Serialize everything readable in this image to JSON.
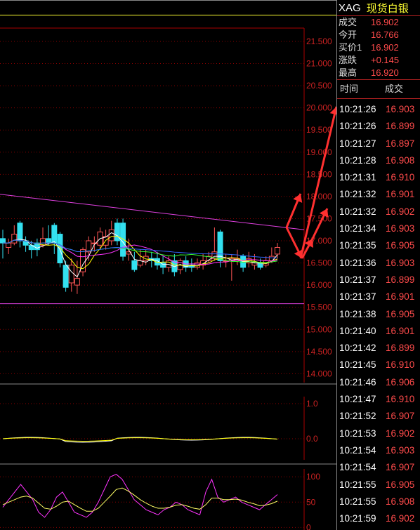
{
  "instrument": {
    "code": "XAG",
    "name": "现货白银"
  },
  "quote": [
    {
      "label": "成交",
      "value": "16.902"
    },
    {
      "label": "今开",
      "value": "16.766"
    },
    {
      "label": "买价1",
      "value": "16.902"
    },
    {
      "label": "涨跌",
      "value": "+0.145"
    },
    {
      "label": "最高",
      "value": "16.920"
    }
  ],
  "tick_header": {
    "time": "时间",
    "price": "成交"
  },
  "ticks": [
    {
      "time": "10:21:26",
      "price": "16.903"
    },
    {
      "time": "10:21:26",
      "price": "16.899"
    },
    {
      "time": "10:21:27",
      "price": "16.897"
    },
    {
      "time": "10:21:28",
      "price": "16.908"
    },
    {
      "time": "10:21:31",
      "price": "16.910"
    },
    {
      "time": "10:21:32",
      "price": "16.901"
    },
    {
      "time": "10:21:32",
      "price": "16.902"
    },
    {
      "time": "10:21:34",
      "price": "16.903"
    },
    {
      "time": "10:21:35",
      "price": "16.905"
    },
    {
      "time": "10:21:36",
      "price": "16.903"
    },
    {
      "time": "10:21:37",
      "price": "16.899"
    },
    {
      "time": "10:21:37",
      "price": "16.901"
    },
    {
      "time": "10:21:38",
      "price": "16.905"
    },
    {
      "time": "10:21:40",
      "price": "16.901"
    },
    {
      "time": "10:21:42",
      "price": "16.899"
    },
    {
      "time": "10:21:45",
      "price": "16.910"
    },
    {
      "time": "10:21:46",
      "price": "16.906"
    },
    {
      "time": "10:21:47",
      "price": "16.910"
    },
    {
      "time": "10:21:52",
      "price": "16.907"
    },
    {
      "time": "10:21:53",
      "price": "16.902"
    },
    {
      "time": "10:21:54",
      "price": "16.903"
    },
    {
      "time": "10:21:54",
      "price": "16.907"
    },
    {
      "time": "10:21:55",
      "price": "16.905"
    },
    {
      "time": "10:21:55",
      "price": "16.908"
    },
    {
      "time": "10:21:59",
      "price": "16.902"
    }
  ],
  "chart_data": [
    {
      "type": "candlestick",
      "y_ticks": [
        "21.500",
        "21.000",
        "20.500",
        "20.000",
        "19.500",
        "19.000",
        "18.500",
        "18.000",
        "17.500",
        "17.000",
        "16.500",
        "16.000",
        "15.500",
        "15.000",
        "14.500",
        "14.000"
      ],
      "ylim": [
        13.8,
        21.8
      ],
      "candles": [
        [
          17.05,
          16.95,
          17.25,
          16.6
        ],
        [
          16.85,
          16.95,
          17.05,
          16.7
        ],
        [
          16.95,
          17.15,
          17.35,
          16.9
        ],
        [
          17.4,
          17.0,
          17.45,
          16.85
        ],
        [
          17.0,
          16.9,
          17.1,
          16.75
        ],
        [
          16.9,
          16.8,
          17.0,
          16.6
        ],
        [
          16.95,
          16.8,
          17.05,
          16.65
        ],
        [
          16.9,
          17.05,
          17.3,
          16.85
        ],
        [
          17.05,
          16.95,
          17.35,
          16.9
        ],
        [
          17.35,
          16.95,
          17.4,
          16.7
        ],
        [
          17.15,
          16.5,
          17.2,
          16.4
        ],
        [
          16.45,
          15.95,
          16.55,
          15.85
        ],
        [
          16.05,
          16.45,
          16.6,
          15.85
        ],
        [
          16.0,
          16.15,
          16.55,
          15.8
        ],
        [
          16.3,
          16.8,
          16.85,
          16.2
        ],
        [
          16.75,
          17.0,
          17.1,
          16.55
        ],
        [
          16.95,
          16.95,
          17.1,
          16.75
        ],
        [
          16.9,
          17.2,
          17.3,
          16.8
        ],
        [
          16.9,
          17.1,
          17.25,
          16.8
        ],
        [
          17.0,
          17.25,
          17.45,
          16.9
        ],
        [
          17.4,
          17.0,
          17.5,
          16.9
        ],
        [
          17.4,
          16.65,
          17.5,
          16.55
        ],
        [
          16.7,
          16.75,
          17.05,
          16.55
        ],
        [
          16.55,
          16.35,
          16.75,
          16.3
        ],
        [
          16.45,
          16.55,
          16.8,
          16.4
        ],
        [
          16.55,
          16.65,
          16.8,
          16.45
        ],
        [
          16.6,
          16.55,
          16.75,
          16.4
        ],
        [
          16.6,
          16.45,
          16.75,
          16.35
        ],
        [
          16.5,
          16.4,
          16.65,
          16.25
        ],
        [
          16.4,
          16.55,
          16.65,
          16.3
        ],
        [
          16.55,
          16.3,
          16.7,
          16.2
        ],
        [
          16.35,
          16.55,
          16.6,
          16.25
        ],
        [
          16.55,
          16.4,
          16.65,
          16.3
        ],
        [
          16.45,
          16.4,
          16.6,
          16.3
        ],
        [
          16.4,
          16.5,
          16.6,
          16.35
        ],
        [
          16.45,
          16.55,
          16.7,
          16.35
        ],
        [
          16.55,
          16.65,
          16.75,
          16.5
        ],
        [
          16.6,
          16.75,
          17.3,
          16.55
        ],
        [
          17.2,
          16.55,
          17.25,
          16.4
        ],
        [
          16.55,
          16.55,
          16.7,
          16.4
        ],
        [
          16.55,
          16.6,
          16.7,
          16.1
        ],
        [
          16.55,
          16.6,
          16.8,
          16.45
        ],
        [
          16.65,
          16.4,
          16.7,
          16.3
        ],
        [
          16.5,
          16.6,
          16.75,
          16.4
        ],
        [
          16.45,
          16.5,
          16.7,
          16.35
        ],
        [
          16.5,
          16.4,
          16.6,
          16.35
        ],
        [
          16.45,
          16.55,
          16.65,
          16.4
        ],
        [
          16.55,
          16.65,
          16.85,
          16.5
        ],
        [
          16.7,
          16.85,
          16.95,
          16.6
        ]
      ],
      "trend_line": [
        [
          0,
          18.05
        ],
        [
          48,
          17.25
        ]
      ],
      "support_line": 15.58
    },
    {
      "type": "line",
      "y_ticks": [
        "1.0",
        "0.0"
      ],
      "ylim": [
        -0.6,
        1.2
      ]
    },
    {
      "type": "line",
      "y_ticks": [
        "100",
        "50",
        "0"
      ],
      "ylim": [
        -5,
        110
      ],
      "series": [
        {
          "values": [
            40,
            55,
            70,
            85,
            70,
            55,
            30,
            20,
            35,
            60,
            70,
            50,
            30,
            25,
            20,
            30,
            50,
            75,
            100,
            105,
            95,
            75,
            55,
            45,
            35,
            30,
            25,
            35,
            40,
            50,
            45,
            35,
            30,
            25,
            70,
            95,
            60,
            50,
            55,
            60,
            50,
            45,
            40,
            35,
            45,
            55,
            65
          ]
        },
        {
          "values": [
            45,
            50,
            55,
            60,
            62,
            58,
            48,
            38,
            36,
            42,
            50,
            52,
            45,
            38,
            32,
            32,
            38,
            50,
            62,
            75,
            78,
            72,
            64,
            55,
            48,
            42,
            38,
            38,
            40,
            44,
            45,
            42,
            38,
            36,
            45,
            58,
            58,
            55,
            55,
            56,
            54,
            50,
            47,
            43,
            44,
            47,
            52
          ]
        }
      ]
    }
  ],
  "colors": {
    "bg": "#000000",
    "grid": "#8b0000",
    "axis_text": "#cc2222",
    "up": "#ff5555",
    "down": "#33e0f0",
    "accent": "#ffff33"
  }
}
